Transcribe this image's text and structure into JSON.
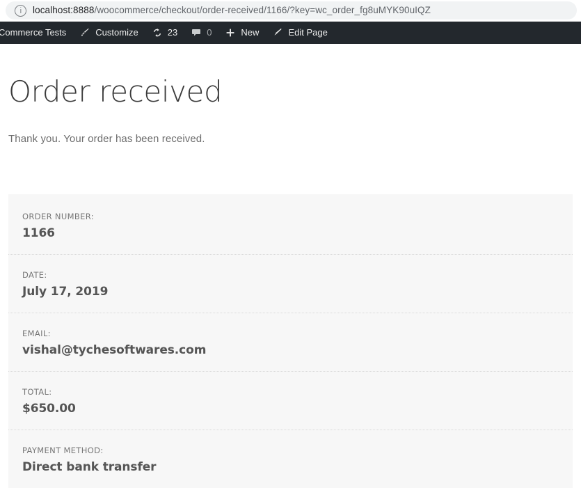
{
  "browser": {
    "info_icon": "info-circle-icon",
    "url_host": "localhost:8888",
    "url_path": "/woocommerce/checkout/order-received/1166/?key=wc_order_fg8uMYK90uIQZ",
    "url_full": "localhost:8888/woocommerce/checkout/order-received/1166/?key=wc_order_fg8uMYK90uIQZ"
  },
  "adminbar": {
    "site_name": "Commerce Tests",
    "customize": {
      "label": "Customize",
      "icon": "paintbrush-icon"
    },
    "updates": {
      "count": "23",
      "icon": "update-arrows-icon"
    },
    "comments": {
      "count": "0",
      "icon": "comment-bubble-icon"
    },
    "new": {
      "label": "New",
      "icon": "plus-icon"
    },
    "edit_page": {
      "label": "Edit Page",
      "icon": "pencil-icon"
    }
  },
  "page": {
    "title": "Order received",
    "thank_you": "Thank you. Your order has been received."
  },
  "order_overview": [
    {
      "label": "ORDER NUMBER:",
      "value": "1166"
    },
    {
      "label": "DATE:",
      "value": "July 17, 2019"
    },
    {
      "label": "EMAIL:",
      "value": "vishal@tychesoftwares.com"
    },
    {
      "label": "TOTAL:",
      "value": "$650.00"
    },
    {
      "label": "PAYMENT METHOD:",
      "value": "Direct bank transfer"
    }
  ],
  "colors": {
    "adminbar_bg": "#23282d",
    "panel_bg": "#f7f7f7",
    "url_pill_bg": "#f1f3f4",
    "value_text": "#555555",
    "label_text": "#777777"
  }
}
